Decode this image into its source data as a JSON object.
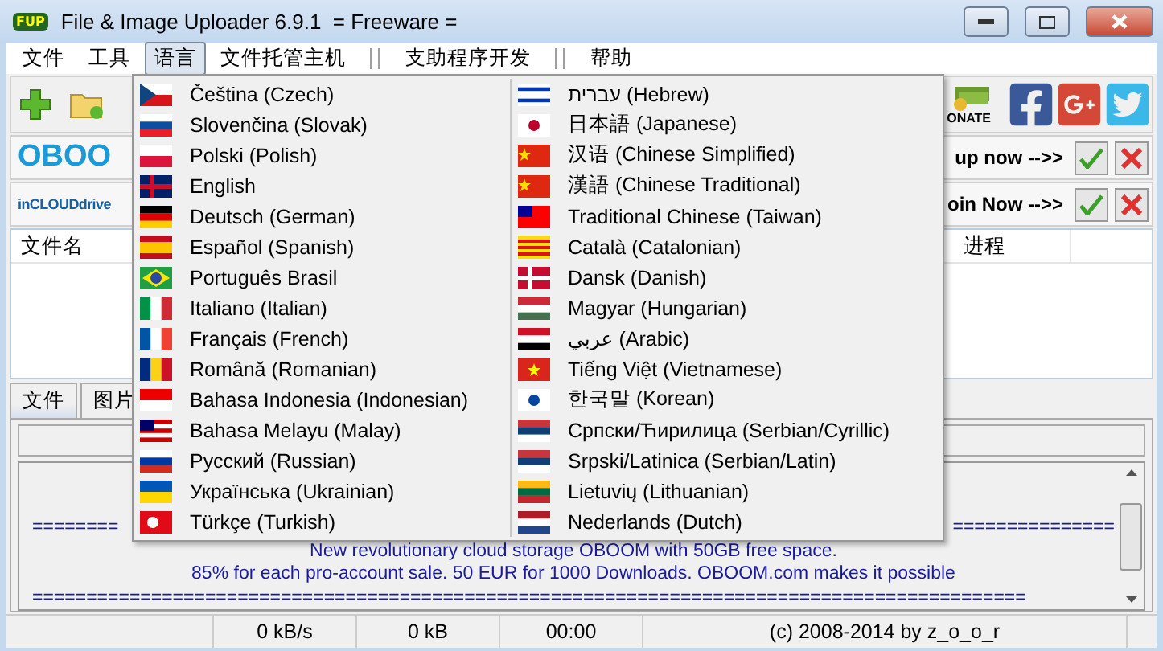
{
  "window": {
    "title": "File & Image Uploader 6.9.1  = Freeware =",
    "app_icon": "FUP"
  },
  "menu_bar": [
    {
      "kind": "item",
      "label": "文件",
      "selected": false
    },
    {
      "kind": "item",
      "label": "工具",
      "selected": false
    },
    {
      "kind": "item",
      "label": "语言",
      "selected": true
    },
    {
      "kind": "item",
      "label": "文件托管主机",
      "selected": false
    },
    {
      "kind": "separator"
    },
    {
      "kind": "item",
      "label": "支助程序开发",
      "selected": false
    },
    {
      "kind": "separator"
    },
    {
      "kind": "item",
      "label": "帮助",
      "selected": false
    }
  ],
  "toolbar": {
    "donate": "ONATE"
  },
  "promos": [
    {
      "logo": "OBOO",
      "action": "up now -->>"
    },
    {
      "logo": "inCLOUDdrive",
      "action": "oin Now -->>"
    }
  ],
  "table": {
    "columns": [
      "文件名",
      "进程"
    ]
  },
  "tabs": [
    {
      "label": "文件",
      "selected": true
    },
    {
      "label": "图片",
      "selected": false
    }
  ],
  "log": [
    {
      "kind": "split",
      "left": "========",
      "right": "==============="
    },
    {
      "kind": "text",
      "text": "New revolutionary cloud storage OBOOM with 50GB free space."
    },
    {
      "kind": "text",
      "text": "85% for each pro-account sale. 50 EUR for 1000 Downloads. OBOOM.com makes it possible"
    },
    {
      "kind": "rule",
      "text": "============================================================================================"
    }
  ],
  "status_bar": [
    "0 kB/s",
    "0 kB",
    "00:00",
    "(c) 2008-2014 by z_o_o_r"
  ],
  "language_menu": [
    [
      {
        "kind": "cz",
        "label": "Čeština (Czech)"
      },
      {
        "kind": "sk",
        "label": "Slovenčina (Slovak)"
      },
      {
        "kind": "pl",
        "label": "Polski (Polish)"
      },
      {
        "kind": "gb",
        "label": "English"
      },
      {
        "kind": "de",
        "label": "Deutsch (German)"
      },
      {
        "kind": "es",
        "label": "Español (Spanish)"
      },
      {
        "kind": "br",
        "label": "Português Brasil"
      },
      {
        "kind": "it",
        "label": "Italiano (Italian)"
      },
      {
        "kind": "fr",
        "label": "Français (French)"
      },
      {
        "kind": "ro",
        "label": "Română (Romanian)"
      },
      {
        "kind": "id",
        "label": "Bahasa Indonesia (Indonesian)"
      },
      {
        "kind": "my",
        "label": "Bahasa Melayu (Malay)"
      },
      {
        "kind": "ru",
        "label": "Русский (Russian)"
      },
      {
        "kind": "ua",
        "label": "Українська (Ukrainian)"
      },
      {
        "kind": "tr",
        "label": "Türkçe (Turkish)"
      }
    ],
    [
      {
        "kind": "il",
        "label": "עברית (Hebrew)"
      },
      {
        "kind": "jp",
        "label": "日本語 (Japanese)"
      },
      {
        "kind": "cn",
        "label": "汉语 (Chinese Simplified)"
      },
      {
        "kind": "cn",
        "label": "漢語 (Chinese Traditional)"
      },
      {
        "kind": "tw",
        "label": "Traditional Chinese (Taiwan)"
      },
      {
        "kind": "ca",
        "label": "Català (Catalonian)"
      },
      {
        "kind": "dk",
        "label": "Dansk (Danish)"
      },
      {
        "kind": "hu",
        "label": "Magyar (Hungarian)"
      },
      {
        "kind": "eg",
        "label": "عربي (Arabic)"
      },
      {
        "kind": "vn",
        "label": "Tiếng Việt (Vietnamese)"
      },
      {
        "kind": "kr",
        "label": "한국말 (Korean)"
      },
      {
        "kind": "rs",
        "label": "Српски/Ћирилица (Serbian/Cyrillic)"
      },
      {
        "kind": "rs",
        "label": "Srpski/Latinica (Serbian/Latin)"
      },
      {
        "kind": "lt",
        "label": "Lietuvių (Lithuanian)"
      },
      {
        "kind": "nl",
        "label": "Nederlands (Dutch)"
      }
    ]
  ]
}
